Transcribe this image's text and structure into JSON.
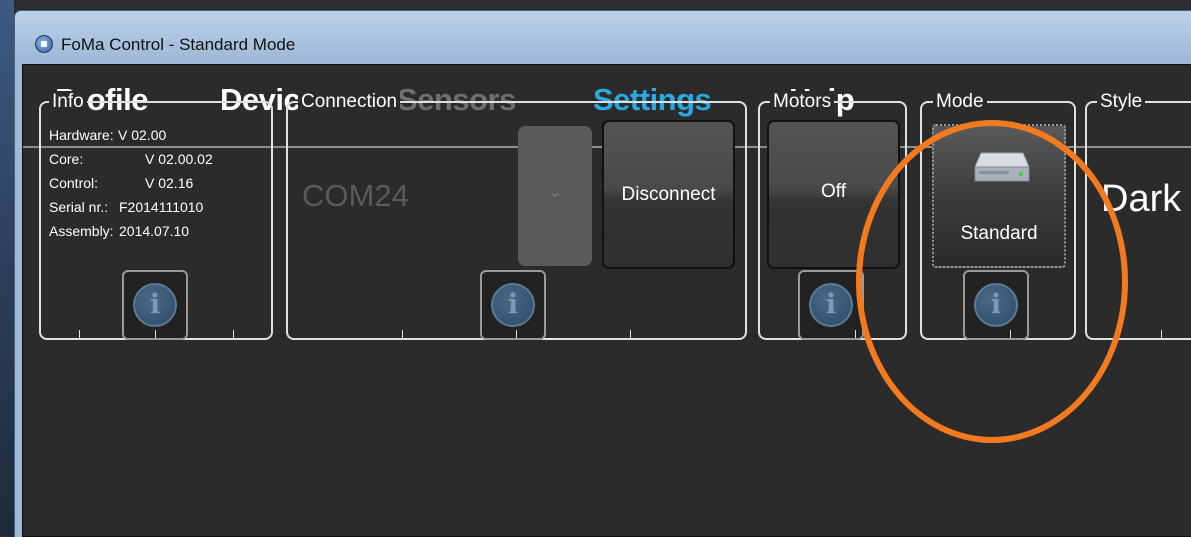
{
  "window": {
    "title": "FoMa Control - Standard Mode"
  },
  "menu": {
    "items": [
      {
        "label": "Profile",
        "state": "normal"
      },
      {
        "label": "Device",
        "state": "normal"
      },
      {
        "label": "Sensors",
        "state": "disabled"
      },
      {
        "label": "Settings",
        "state": "active"
      },
      {
        "label": "Help",
        "state": "normal"
      }
    ]
  },
  "groups": {
    "info": {
      "label": "Info",
      "rows": [
        {
          "key": "Hardware:",
          "value": "V 02.00"
        },
        {
          "key": "Core:",
          "value": "V 02.00.02"
        },
        {
          "key": "Control:",
          "value": "V 02.16"
        },
        {
          "key": "Serial nr.:",
          "value": "F2014111010"
        },
        {
          "key": "Assembly:",
          "value": "2014.07.10"
        }
      ],
      "info_button_glyph": "i"
    },
    "connection": {
      "label": "Connection",
      "port_value": "COM24",
      "dropdown_glyph": "⌄",
      "disconnect_label": "Disconnect",
      "info_button_glyph": "i"
    },
    "motors": {
      "label": "Motors",
      "toggle_label": "Off",
      "info_button_glyph": "i"
    },
    "mode": {
      "label": "Mode",
      "mode_label": "Standard",
      "info_button_glyph": "i",
      "icon": "drive-icon"
    },
    "style": {
      "label": "Style",
      "value": "Dark"
    }
  },
  "colors": {
    "menu_normal": "#ffffff",
    "menu_disabled": "#6e6e6e",
    "menu_active": "#29a9e1",
    "annotation": "#f47a20",
    "panel_bg": "#2b2b2b"
  }
}
